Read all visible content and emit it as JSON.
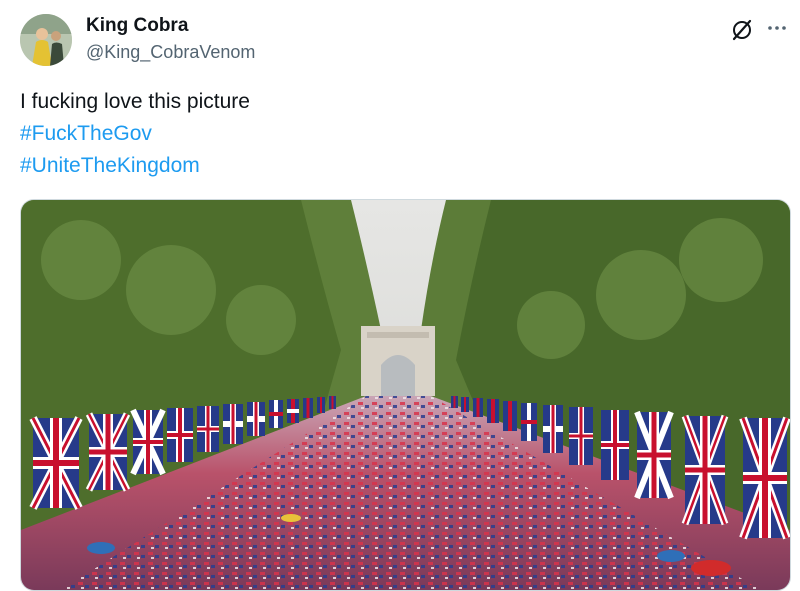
{
  "tweet": {
    "author_name": "King Cobra",
    "author_handle": "@King_CobraVenom",
    "text_line": "I fucking love this picture",
    "hashtags": [
      "#FuckTheGov",
      "#UniteTheKingdom"
    ]
  },
  "icons": {
    "grok": "grok-icon",
    "more": "more-icon"
  },
  "colors": {
    "link": "#1d9bf0",
    "secondary_text": "#536471",
    "primary_text": "#0f1419"
  }
}
